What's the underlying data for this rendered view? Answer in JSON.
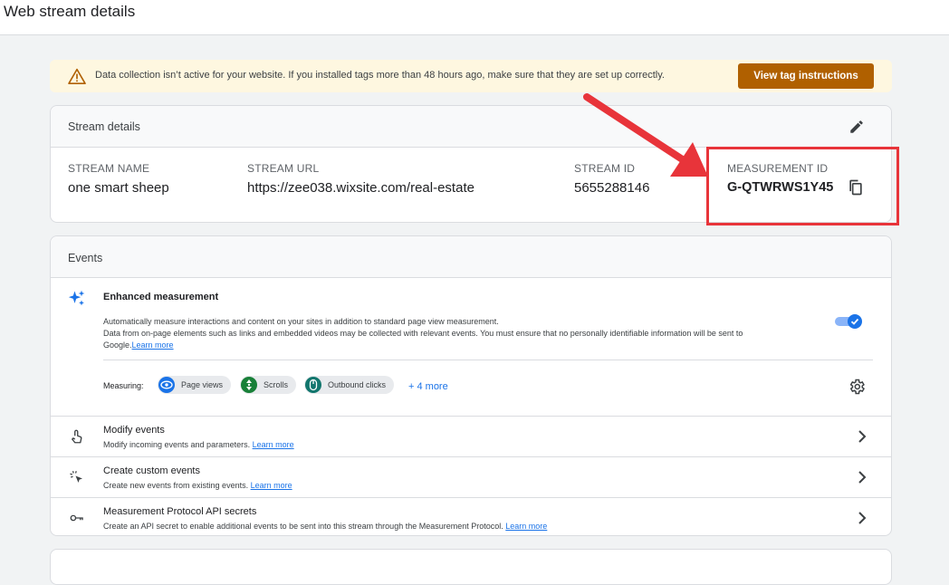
{
  "page": {
    "title": "Web stream details"
  },
  "banner": {
    "icon": "warning-icon",
    "message": "Data collection isn’t active for your website. If you installed tags more than 48 hours ago, make sure that they are set up correctly.",
    "button_label": "View tag instructions",
    "background": "#fef7e0",
    "button_color": "#b06000"
  },
  "stream_details": {
    "title": "Stream details",
    "edit_icon": "pencil-icon",
    "fields": {
      "stream_name": {
        "label": "STREAM NAME",
        "value": "one smart sheep"
      },
      "stream_url": {
        "label": "STREAM URL",
        "value": "https://zee038.wixsite.com/real-estate"
      },
      "stream_id": {
        "label": "STREAM ID",
        "value": "5655288146"
      },
      "measurement_id": {
        "label": "MEASUREMENT ID",
        "value": "G-QTWRWS1Y45"
      }
    },
    "copy_icon": "copy-icon",
    "highlight_color": "#e8343a"
  },
  "events": {
    "title": "Events",
    "enhanced": {
      "title": "Enhanced measurement",
      "desc_line1": "Automatically measure interactions and content on your sites in addition to standard page view measurement.",
      "desc_line2": "Data from on-page elements such as links and embedded videos may be collected with relevant events. You must ensure that no personally identifiable information will be sent to",
      "desc_line3": "Google.",
      "learn_more": "Learn more",
      "toggle_on": true,
      "measuring_label": "Measuring:",
      "chips": [
        {
          "label": "Page views",
          "icon": "eye-icon",
          "color": "#1a73e8"
        },
        {
          "label": "Scrolls",
          "icon": "scroll-icon",
          "color": "#188038"
        },
        {
          "label": "Outbound clicks",
          "icon": "mouse-icon",
          "color": "#12766d"
        }
      ],
      "more": "+ 4 more"
    },
    "rows": [
      {
        "title": "Modify events",
        "subtitle": "Modify incoming events and parameters.",
        "learn_more": "Learn more",
        "icon": "touch-icon"
      },
      {
        "title": "Create custom events",
        "subtitle": "Create new events from existing events.",
        "learn_more": "Learn more",
        "icon": "sparkle-cursor-icon"
      },
      {
        "title": "Measurement Protocol API secrets",
        "subtitle": "Create an API secret to enable additional events to be sent into this stream through the Measurement Protocol.",
        "learn_more": "Learn more",
        "icon": "key-icon"
      }
    ]
  }
}
